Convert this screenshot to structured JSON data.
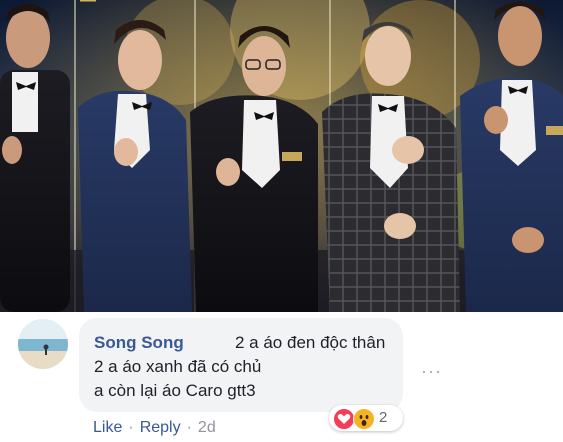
{
  "image": {
    "description_icon": "tv-show-photo"
  },
  "comment": {
    "author": "Song Song",
    "lines": [
      "2 a áo đen độc thân",
      "2 a áo xanh đã có chủ",
      "a còn lại áo Caro gtt3"
    ],
    "reaction_icons": [
      "love-icon",
      "wow-icon"
    ],
    "reaction_count": "2",
    "more_label": "···",
    "actions": {
      "like": "Like",
      "reply": "Reply",
      "time": "2d"
    }
  },
  "colors": {
    "link": "#385898",
    "bubble": "#f2f3f5",
    "love": "#f33e58",
    "wow": "#f7b125"
  }
}
